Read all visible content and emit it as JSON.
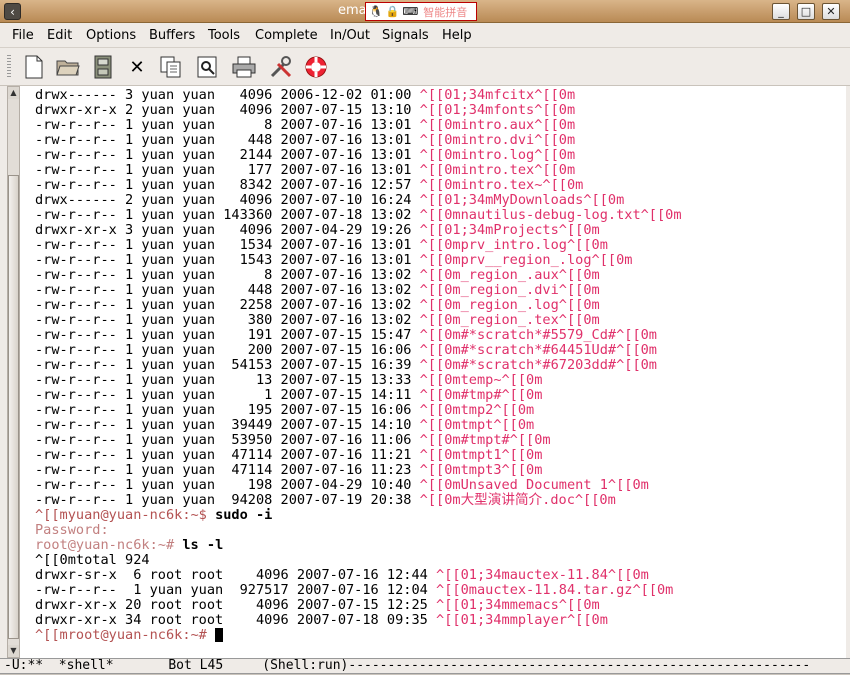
{
  "window": {
    "title": "ema",
    "app_icon": "emacs-window-icon",
    "controls": [
      "minimize-icon",
      "maximize-icon",
      "close-icon"
    ]
  },
  "ime": {
    "icons": [
      "penguin-icon",
      "lock-icon",
      "keyboard-icon"
    ],
    "label": "智能拼音"
  },
  "menu": [
    "File",
    "Edit",
    "Options",
    "Buffers",
    "Tools",
    "Complete",
    "In/Out",
    "Signals",
    "Help"
  ],
  "toolbar": {
    "buttons": [
      "new-file-icon",
      "open-folder-icon",
      "save-icon",
      "close-buffer-icon",
      "copy-icon",
      "find-icon",
      "print-icon",
      "customize-icon",
      "help-icon"
    ]
  },
  "buffer": {
    "lines": [
      [
        {
          "t": "drwx------ 3 yuan yuan   4096 2006-12-02 01:00 ",
          "c": "txt"
        },
        {
          "t": "^[[01;34mfcitx^[[0m",
          "c": "esc"
        }
      ],
      [
        {
          "t": "drwxr-xr-x 2 yuan yuan   4096 2007-07-15 13:10 ",
          "c": "txt"
        },
        {
          "t": "^[[01;34mfonts^[[0m",
          "c": "esc"
        }
      ],
      [
        {
          "t": "-rw-r--r-- 1 yuan yuan      8 2007-07-16 13:01 ",
          "c": "txt"
        },
        {
          "t": "^[[0mintro.aux^[[0m",
          "c": "esc"
        }
      ],
      [
        {
          "t": "-rw-r--r-- 1 yuan yuan    448 2007-07-16 13:01 ",
          "c": "txt"
        },
        {
          "t": "^[[0mintro.dvi^[[0m",
          "c": "esc"
        }
      ],
      [
        {
          "t": "-rw-r--r-- 1 yuan yuan   2144 2007-07-16 13:01 ",
          "c": "txt"
        },
        {
          "t": "^[[0mintro.log^[[0m",
          "c": "esc"
        }
      ],
      [
        {
          "t": "-rw-r--r-- 1 yuan yuan    177 2007-07-16 13:01 ",
          "c": "txt"
        },
        {
          "t": "^[[0mintro.tex^[[0m",
          "c": "esc"
        }
      ],
      [
        {
          "t": "-rw-r--r-- 1 yuan yuan   8342 2007-07-16 12:57 ",
          "c": "txt"
        },
        {
          "t": "^[[0mintro.tex~^[[0m",
          "c": "esc"
        }
      ],
      [
        {
          "t": "drwx------ 2 yuan yuan   4096 2007-07-10 16:24 ",
          "c": "txt"
        },
        {
          "t": "^[[01;34mMyDownloads^[[0m",
          "c": "esc"
        }
      ],
      [
        {
          "t": "-rw-r--r-- 1 yuan yuan 143360 2007-07-18 13:02 ",
          "c": "txt"
        },
        {
          "t": "^[[0mnautilus-debug-log.txt^[[0m",
          "c": "esc"
        }
      ],
      [
        {
          "t": "drwxr-xr-x 3 yuan yuan   4096 2007-04-29 19:26 ",
          "c": "txt"
        },
        {
          "t": "^[[01;34mProjects^[[0m",
          "c": "esc"
        }
      ],
      [
        {
          "t": "-rw-r--r-- 1 yuan yuan   1534 2007-07-16 13:01 ",
          "c": "txt"
        },
        {
          "t": "^[[0mprv_intro.log^[[0m",
          "c": "esc"
        }
      ],
      [
        {
          "t": "-rw-r--r-- 1 yuan yuan   1543 2007-07-16 13:01 ",
          "c": "txt"
        },
        {
          "t": "^[[0mprv__region_.log^[[0m",
          "c": "esc"
        }
      ],
      [
        {
          "t": "-rw-r--r-- 1 yuan yuan      8 2007-07-16 13:02 ",
          "c": "txt"
        },
        {
          "t": "^[[0m_region_.aux^[[0m",
          "c": "esc"
        }
      ],
      [
        {
          "t": "-rw-r--r-- 1 yuan yuan    448 2007-07-16 13:02 ",
          "c": "txt"
        },
        {
          "t": "^[[0m_region_.dvi^[[0m",
          "c": "esc"
        }
      ],
      [
        {
          "t": "-rw-r--r-- 1 yuan yuan   2258 2007-07-16 13:02 ",
          "c": "txt"
        },
        {
          "t": "^[[0m_region_.log^[[0m",
          "c": "esc"
        }
      ],
      [
        {
          "t": "-rw-r--r-- 1 yuan yuan    380 2007-07-16 13:02 ",
          "c": "txt"
        },
        {
          "t": "^[[0m_region_.tex^[[0m",
          "c": "esc"
        }
      ],
      [
        {
          "t": "-rw-r--r-- 1 yuan yuan    191 2007-07-15 15:47 ",
          "c": "txt"
        },
        {
          "t": "^[[0m#*scratch*#5579_Cd#^[[0m",
          "c": "esc"
        }
      ],
      [
        {
          "t": "-rw-r--r-- 1 yuan yuan    200 2007-07-15 16:06 ",
          "c": "txt"
        },
        {
          "t": "^[[0m#*scratch*#64451Ud#^[[0m",
          "c": "esc"
        }
      ],
      [
        {
          "t": "-rw-r--r-- 1 yuan yuan  54153 2007-07-15 16:39 ",
          "c": "txt"
        },
        {
          "t": "^[[0m#*scratch*#67203dd#^[[0m",
          "c": "esc"
        }
      ],
      [
        {
          "t": "-rw-r--r-- 1 yuan yuan     13 2007-07-15 13:33 ",
          "c": "txt"
        },
        {
          "t": "^[[0mtemp~^[[0m",
          "c": "esc"
        }
      ],
      [
        {
          "t": "-rw-r--r-- 1 yuan yuan      1 2007-07-15 14:11 ",
          "c": "txt"
        },
        {
          "t": "^[[0m#tmp#^[[0m",
          "c": "esc"
        }
      ],
      [
        {
          "t": "-rw-r--r-- 1 yuan yuan    195 2007-07-15 16:06 ",
          "c": "txt"
        },
        {
          "t": "^[[0mtmp2^[[0m",
          "c": "esc"
        }
      ],
      [
        {
          "t": "-rw-r--r-- 1 yuan yuan  39449 2007-07-15 14:10 ",
          "c": "txt"
        },
        {
          "t": "^[[0mtmpt^[[0m",
          "c": "esc"
        }
      ],
      [
        {
          "t": "-rw-r--r-- 1 yuan yuan  53950 2007-07-16 11:06 ",
          "c": "txt"
        },
        {
          "t": "^[[0m#tmpt#^[[0m",
          "c": "esc"
        }
      ],
      [
        {
          "t": "-rw-r--r-- 1 yuan yuan  47114 2007-07-16 11:21 ",
          "c": "txt"
        },
        {
          "t": "^[[0mtmpt1^[[0m",
          "c": "esc"
        }
      ],
      [
        {
          "t": "-rw-r--r-- 1 yuan yuan  47114 2007-07-16 11:23 ",
          "c": "txt"
        },
        {
          "t": "^[[0mtmpt3^[[0m",
          "c": "esc"
        }
      ],
      [
        {
          "t": "-rw-r--r-- 1 yuan yuan    198 2007-04-29 10:40 ",
          "c": "txt"
        },
        {
          "t": "^[[0mUnsaved Document 1^[[0m",
          "c": "esc"
        }
      ],
      [
        {
          "t": "-rw-r--r-- 1 yuan yuan  94208 2007-07-19 20:38 ",
          "c": "txt"
        },
        {
          "t": "^[[0m大型演讲简介.doc^[[0m",
          "c": "esc"
        }
      ],
      [
        {
          "t": "^[[myuan@yuan-nc6k:~$ ",
          "c": "prompt"
        },
        {
          "t": "sudo -i",
          "c": "cmd"
        }
      ],
      [
        {
          "t": "Password:",
          "c": "prompt2"
        }
      ],
      [
        {
          "t": "root@yuan-nc6k:~# ",
          "c": "prompt2"
        },
        {
          "t": "ls -l",
          "c": "cmd"
        }
      ],
      [
        {
          "t": "^[[0mtotal 924",
          "c": "txt"
        }
      ],
      [
        {
          "t": "drwxr-sr-x  6 root root    4096 2007-07-16 12:44 ",
          "c": "txt"
        },
        {
          "t": "^[[01;34mauctex-11.84^[[0m",
          "c": "esc"
        }
      ],
      [
        {
          "t": "-rw-r--r--  1 yuan yuan  927517 2007-07-16 12:04 ",
          "c": "txt"
        },
        {
          "t": "^[[0mauctex-11.84.tar.gz^[[0m",
          "c": "esc"
        }
      ],
      [
        {
          "t": "drwxr-xr-x 20 root root    4096 2007-07-15 12:25 ",
          "c": "txt"
        },
        {
          "t": "^[[01;34mmemacs^[[0m",
          "c": "esc"
        }
      ],
      [
        {
          "t": "drwxr-xr-x 34 root root    4096 2007-07-18 09:35 ",
          "c": "txt"
        },
        {
          "t": "^[[01;34mmplayer^[[0m",
          "c": "esc"
        }
      ],
      [
        {
          "t": "^[[mroot@yuan-nc6k:~# ",
          "c": "prompt"
        }
      ]
    ]
  },
  "modeline": {
    "text": "-U:**  *shell*       Bot L45     (Shell:run)-----------------------------------------------------------"
  }
}
